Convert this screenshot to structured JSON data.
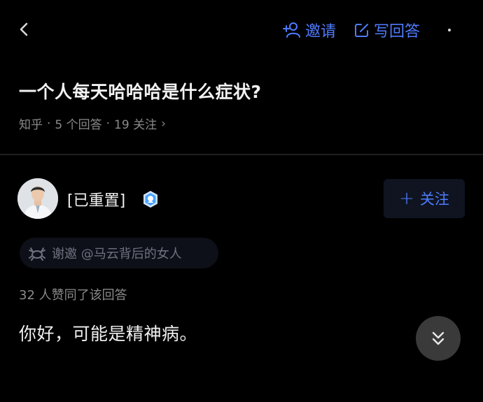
{
  "header": {
    "invite_label": "邀请",
    "write_answer_label": "写回答"
  },
  "question": {
    "title": "一个人每天哈哈哈是什么症状?",
    "source": "知乎",
    "answers": "5 个回答",
    "followers": "19 关注",
    "chevron": "›"
  },
  "answer": {
    "author": "[已重置]",
    "follow_label": "关注",
    "thanks_text": "谢邀 @马云背后的女人",
    "agree_text": "32 人赞同了该回答",
    "content": "你好，可能是精神病。"
  },
  "colors": {
    "accent": "#4e7cff",
    "background": "#000000",
    "muted": "#8a8a8a"
  },
  "icons": [
    "back-icon",
    "add-person-icon",
    "edit-icon",
    "more-icon",
    "verified-badge-icon",
    "crab-icon",
    "double-chevron-down-icon"
  ]
}
